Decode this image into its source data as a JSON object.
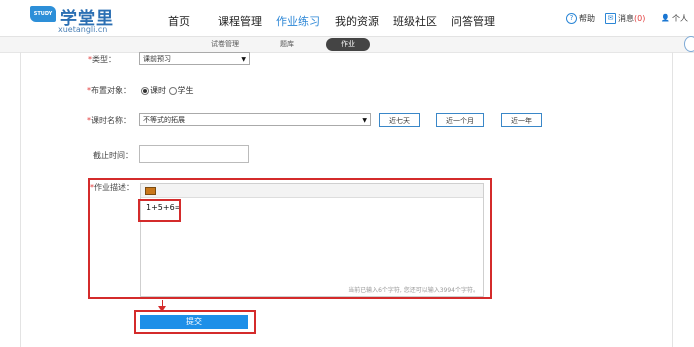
{
  "header": {
    "logo_badge": "STUDY",
    "logo_title": "学堂里",
    "logo_sub": "xuetangli.cn",
    "nav": [
      "首页",
      "课程管理",
      "作业练习",
      "我的资源",
      "班级社区",
      "问答管理"
    ],
    "nav_active_index": 2,
    "help_label": "帮助",
    "messages_label": "消息",
    "messages_count": "(0)",
    "user_label": "个人"
  },
  "subnav": {
    "items": [
      "试卷管理",
      "题库"
    ],
    "active_label": "作业"
  },
  "form": {
    "type_label": "类型：",
    "type_value": "课前预习",
    "target_label": "布置对象：",
    "target_options": [
      "课时",
      "学生"
    ],
    "target_selected": "课时",
    "lesson_label": "课时名称：",
    "lesson_value": "不等式的拓展",
    "date_buttons": [
      "近七天",
      "近一个月",
      "近一年"
    ],
    "deadline_label": "截止时间：",
    "desc_label": "作业描述：",
    "desc_text": "1+5+6=",
    "char_count_text": "当前已输入6个字符, 您还可以输入3994个字符。",
    "submit_label": "提交"
  },
  "colors": {
    "accent": "#2b86d6",
    "annotation_red": "#d42b2b",
    "submit": "#1d8fe8"
  }
}
